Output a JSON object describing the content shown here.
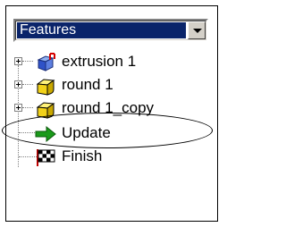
{
  "dropdown": {
    "selected": "Features"
  },
  "tree": {
    "items": [
      {
        "label": "extrusion 1",
        "icon": "extrusion-icon",
        "expandable": true
      },
      {
        "label": "round 1",
        "icon": "round-icon",
        "expandable": true
      },
      {
        "label": "round 1_copy",
        "icon": "round-icon",
        "expandable": true,
        "highlighted": true
      },
      {
        "label": "Update",
        "icon": "update-arrow-icon",
        "expandable": false
      },
      {
        "label": "Finish",
        "icon": "finish-flag-icon",
        "expandable": false
      }
    ]
  },
  "colors": {
    "selection": "#0a246a",
    "arrow": "#1a9a1a",
    "cube_yellow": "#f2d21a",
    "cube_blue": "#3a5fd0"
  }
}
